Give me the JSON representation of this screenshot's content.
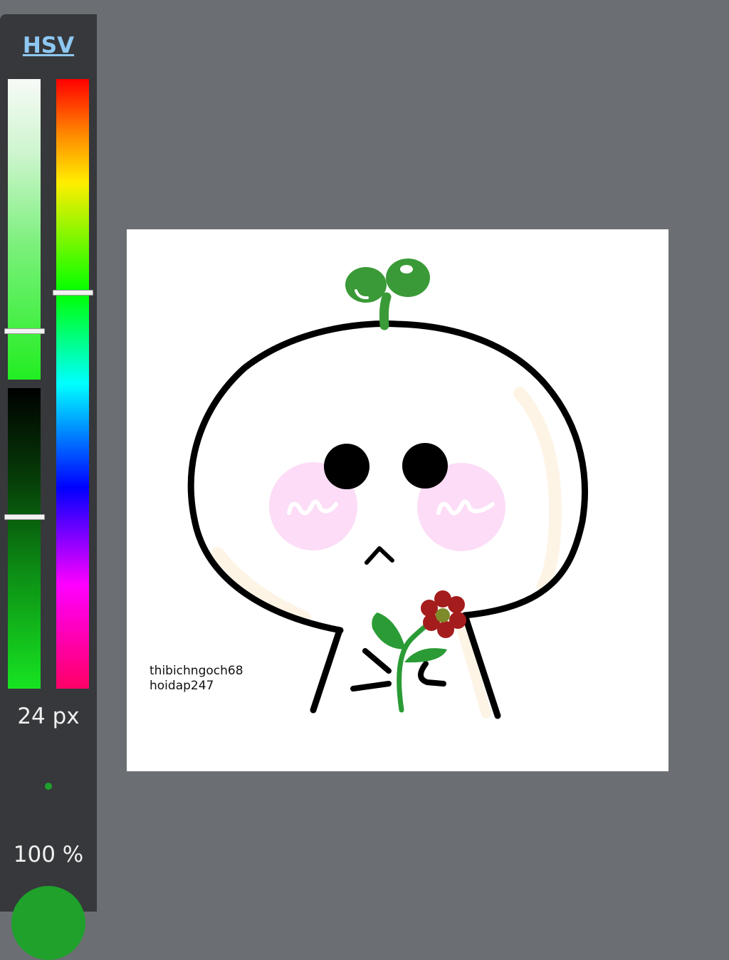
{
  "panel": {
    "mode_tab": "HSV",
    "size_label": "24 px",
    "opacity_label": "100 %",
    "current_color": "#1fa12c",
    "saturation_level": 0.84,
    "value_level": 0.43,
    "hue_level": 0.35
  },
  "canvas": {
    "signature_line1": "thibichngoch68",
    "signature_line2": "hoidap247"
  },
  "colors": {
    "panel_bg": "#36383b",
    "workspace_bg": "#6b6e73",
    "accent_link": "#8ec8f2",
    "sprout_green": "#3a9a37",
    "blush_pink": "#fcdcf6",
    "flower_red": "#a41c1c"
  }
}
